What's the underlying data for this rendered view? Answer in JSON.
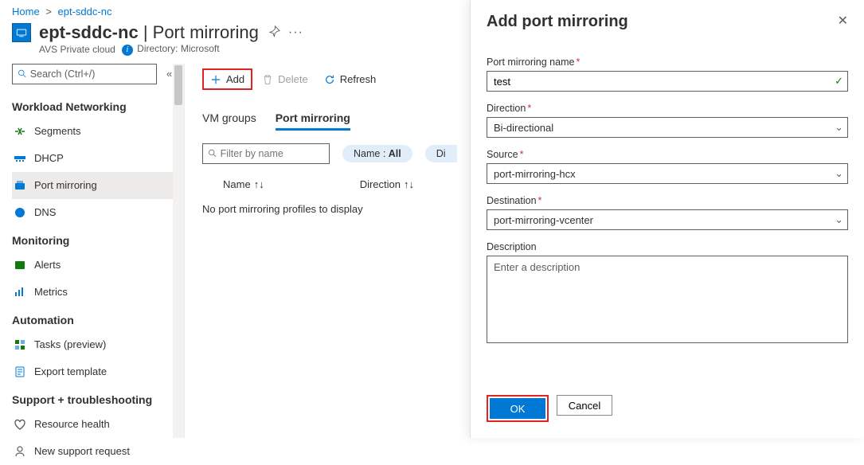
{
  "breadcrumb": {
    "home": "Home",
    "resource": "ept-sddc-nc"
  },
  "header": {
    "title": "ept-sddc-nc",
    "subtitle": "Port mirroring",
    "service": "AVS Private cloud",
    "directory_label": "Directory:",
    "directory_value": "Microsoft"
  },
  "search": {
    "placeholder": "Search (Ctrl+/)"
  },
  "sidebar": {
    "groups": [
      {
        "title": "Workload Networking",
        "items": [
          "Segments",
          "DHCP",
          "Port mirroring",
          "DNS"
        ],
        "active_index": 2
      },
      {
        "title": "Monitoring",
        "items": [
          "Alerts",
          "Metrics"
        ]
      },
      {
        "title": "Automation",
        "items": [
          "Tasks (preview)",
          "Export template"
        ]
      },
      {
        "title": "Support + troubleshooting",
        "items": [
          "Resource health",
          "New support request"
        ]
      }
    ]
  },
  "toolbar": {
    "add": "Add",
    "delete": "Delete",
    "refresh": "Refresh"
  },
  "tabs": {
    "vm_groups": "VM groups",
    "port_mirroring": "Port mirroring"
  },
  "filters": {
    "placeholder": "Filter by name",
    "pill_name_label": "Name :",
    "pill_name_value": "All",
    "pill_cut_prefix": "Di"
  },
  "columns": {
    "name": "Name",
    "direction": "Direction"
  },
  "empty": "No port mirroring profiles to display",
  "panel": {
    "title": "Add port mirroring",
    "fields": {
      "name_label": "Port mirroring name",
      "name_value": "test",
      "direction_label": "Direction",
      "direction_value": "Bi-directional",
      "source_label": "Source",
      "source_value": "port-mirroring-hcx",
      "destination_label": "Destination",
      "destination_value": "port-mirroring-vcenter",
      "description_label": "Description",
      "description_placeholder": "Enter a description"
    },
    "buttons": {
      "ok": "OK",
      "cancel": "Cancel"
    }
  }
}
